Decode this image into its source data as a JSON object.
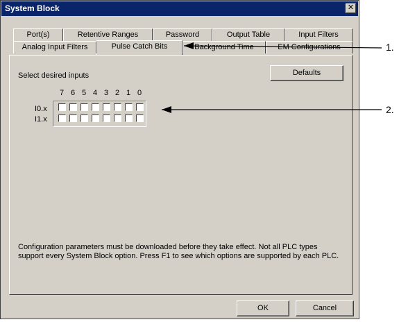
{
  "window": {
    "title": "System Block",
    "close_glyph": "✕"
  },
  "tabs_row1": [
    "Port(s)",
    "Retentive Ranges",
    "Password",
    "Output Table",
    "Input Filters"
  ],
  "tabs_row2": [
    "Analog Input Filters",
    "Pulse Catch Bits",
    "Background Time",
    "EM Configurations"
  ],
  "active_tab": "Pulse Catch Bits",
  "panel": {
    "select_label": "Select desired inputs",
    "defaults_label": "Defaults",
    "bit_numbers": [
      "7",
      "6",
      "5",
      "4",
      "3",
      "2",
      "1",
      "0"
    ],
    "rows": [
      {
        "label": "I0.x",
        "checked": [
          false,
          false,
          false,
          false,
          false,
          false,
          false,
          false
        ]
      },
      {
        "label": "I1.x",
        "checked": [
          false,
          false,
          false,
          false,
          false,
          false,
          false,
          false
        ]
      }
    ],
    "note": "Configuration parameters must be downloaded before they take effect. Not all PLC types support every System Block option.  Press F1 to see which options are supported by each PLC."
  },
  "buttons": {
    "ok": "OK",
    "cancel": "Cancel"
  },
  "callouts": [
    "1.",
    "2."
  ],
  "colors": {
    "titlebar": "#0a246a",
    "dialog_face": "#d4d0c8",
    "arrow": "#000000"
  }
}
